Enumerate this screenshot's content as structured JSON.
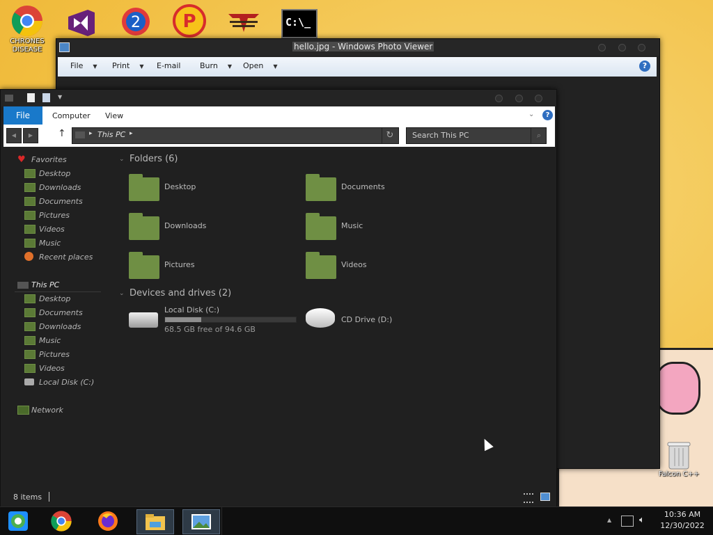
{
  "desktop": {
    "icons": [
      {
        "label": "CHRONES DISEASE",
        "icon": "chrome-icon"
      },
      {
        "label": "",
        "icon": "visual-studio-icon"
      },
      {
        "label": "",
        "icon": "game-2-icon"
      },
      {
        "label": "",
        "icon": "game-p-icon"
      },
      {
        "label": "",
        "icon": "eagle-icon"
      },
      {
        "label": "",
        "icon": "command-prompt-icon"
      }
    ],
    "cmd_text": "C:\\_",
    "recycle_label": "Falcon C++"
  },
  "photo_viewer": {
    "title": "hello.jpg - Windows Photo Viewer",
    "menu": [
      "File",
      "Print",
      "E-mail",
      "Burn",
      "Open"
    ],
    "help": "?"
  },
  "explorer": {
    "tabs": {
      "file": "File",
      "computer": "Computer",
      "view": "View"
    },
    "address": "This PC",
    "search_placeholder": "Search This PC",
    "sidebar": {
      "favorites": "Favorites",
      "favorites_items": [
        "Desktop",
        "Downloads",
        "Documents",
        "Pictures",
        "Videos",
        "Music",
        "Recent places"
      ],
      "this_pc": "This PC",
      "this_pc_items": [
        "Desktop",
        "Documents",
        "Downloads",
        "Music",
        "Pictures",
        "Videos",
        "Local Disk (C:)"
      ],
      "network": "Network"
    },
    "folders_title": "Folders (6)",
    "folders": [
      "Desktop",
      "Documents",
      "Downloads",
      "Music",
      "Pictures",
      "Videos"
    ],
    "drives_title": "Devices and drives (2)",
    "drives": [
      {
        "name": "Local Disk (C:)",
        "detail": "68.5 GB free of 94.6 GB",
        "used_fraction": 0.276
      },
      {
        "name": "CD Drive (D:)",
        "detail": ""
      }
    ],
    "status": "8 items"
  },
  "taskbar": {
    "time": "10:36 AM",
    "date": "12/30/2022",
    "tray_arrow": "▲"
  }
}
